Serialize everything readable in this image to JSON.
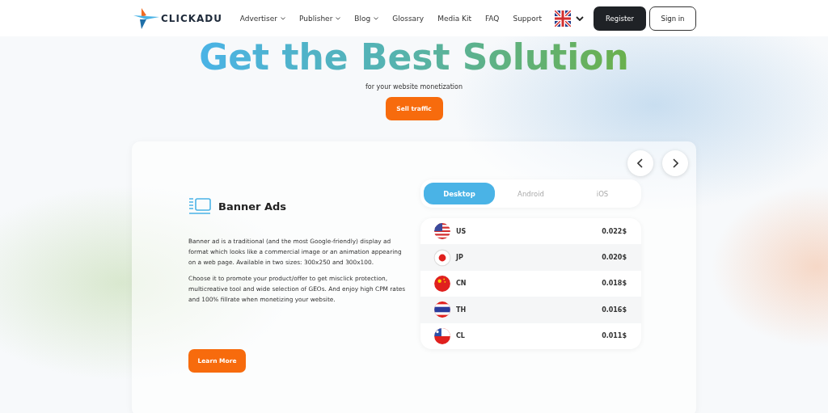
{
  "header": {
    "logo": "CLICKADU",
    "nav": [
      {
        "label": "Advertiser",
        "has_menu": true
      },
      {
        "label": "Publisher",
        "has_menu": true
      },
      {
        "label": "Blog",
        "has_menu": true
      },
      {
        "label": "Glossary",
        "has_menu": false
      },
      {
        "label": "Media Kit",
        "has_menu": false
      },
      {
        "label": "FAQ",
        "has_menu": false
      },
      {
        "label": "Support",
        "has_menu": false
      }
    ],
    "register": "Register",
    "sign_in": "Sign in"
  },
  "hero": {
    "title": "Get the Best Solution",
    "subtitle": "for your website monetization",
    "cta": "Sell traffic"
  },
  "card": {
    "title": "Banner Ads",
    "paragraphs": [
      "Banner ad is a traditional (and the most Google-friendly) display ad format which looks like a commercial image or an animation appearing on a web page. Available in two sizes: 300x250 and 300x100.",
      "Choose it to promote your product/offer to get misclick protection, multicreative tool and wide selection of GEOs. And enjoy high CPM rates and 100% fillrate when monetizing your website."
    ],
    "button": "Learn More",
    "tabs": [
      {
        "label": "Desktop",
        "selected": true
      },
      {
        "label": "Android",
        "selected": false
      },
      {
        "label": "iOS",
        "selected": false
      }
    ],
    "rates": [
      {
        "kind": "us",
        "country": "US",
        "rate": "0.022$"
      },
      {
        "kind": "jp",
        "country": "JP",
        "rate": "0.020$"
      },
      {
        "kind": "cn",
        "country": "CN",
        "rate": "0.018$"
      },
      {
        "kind": "th",
        "country": "TH",
        "rate": "0.016$"
      },
      {
        "kind": "cl",
        "country": "CL",
        "rate": "0.011$"
      }
    ]
  }
}
